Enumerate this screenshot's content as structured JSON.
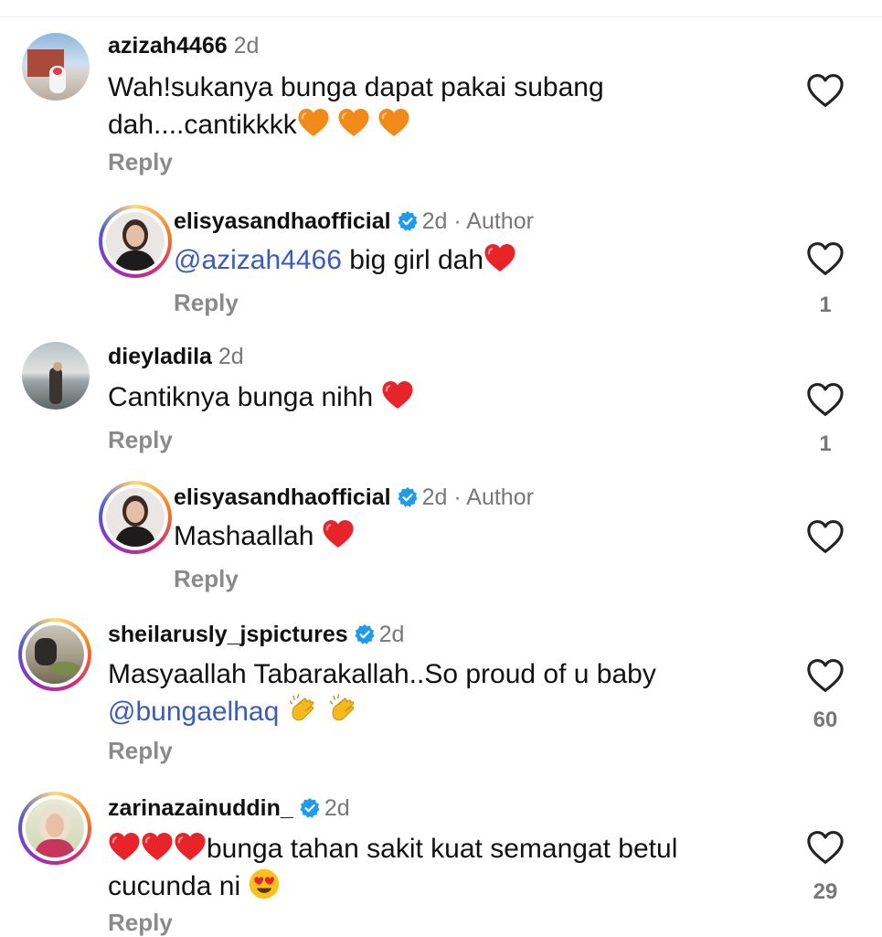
{
  "comments": [
    {
      "username": "azizah4466",
      "time": "2d",
      "text": "Wah!sukanya bunga dapat pakai subang",
      "text2": "dah....cantikkkk",
      "reply": "Reply",
      "likes": ""
    },
    {
      "username": "elisyasandhaofficial",
      "time": "2d",
      "author": "Author",
      "mention": "@azizah4466",
      "text": " big girl dah",
      "reply": "Reply",
      "likes": "1"
    },
    {
      "username": "dieyladila",
      "time": "2d",
      "text": "Cantiknya bunga nihh ",
      "reply": "Reply",
      "likes": "1"
    },
    {
      "username": "elisyasandhaofficial",
      "time": "2d",
      "author": "Author",
      "text": "Mashaallah ",
      "reply": "Reply",
      "likes": ""
    },
    {
      "username": "sheilarusly_jspictures",
      "time": "2d",
      "text": "Masyaallah Tabarakallah..So proud of u baby",
      "mention": "@bungaelhaq",
      "reply": "Reply",
      "likes": "60"
    },
    {
      "username": "zarinazainuddin_",
      "time": "2d",
      "text": "bunga tahan sakit kuat semangat betul",
      "text2": "cucunda ni ",
      "reply": "Reply",
      "likes": "29"
    }
  ],
  "separator": " · ",
  "icons": {
    "like": "heart-outline-icon",
    "verified": "verified-badge-icon"
  },
  "colors": {
    "mention": "#3b5bb8",
    "verified": "#1d9bf0",
    "heart_emoji": "#e8242b",
    "orange_heart": "#f28a1a"
  }
}
